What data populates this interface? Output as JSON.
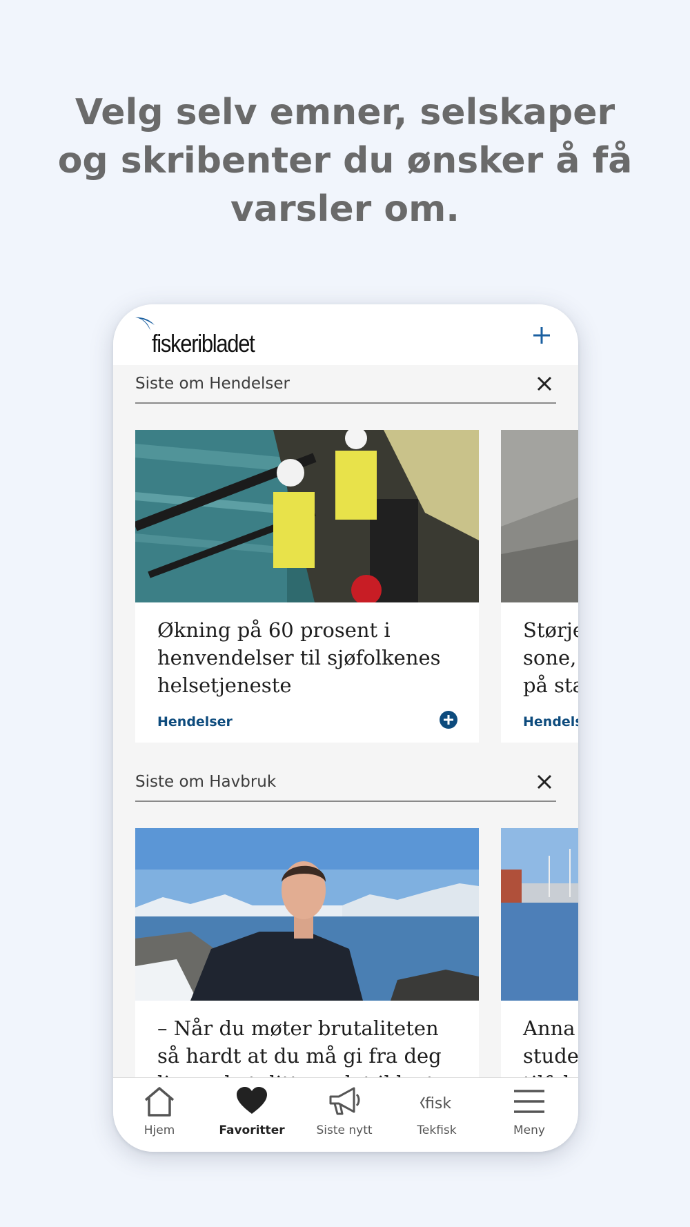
{
  "promo": {
    "headline_lines": [
      "Velg selv emner, selskaper",
      "og skribenter du ønsker å få",
      "varsler om."
    ]
  },
  "app": {
    "logo_text": "fiskeribladet",
    "add_icon": "plus-icon",
    "accent_color": "#0d4b7d"
  },
  "sections": [
    {
      "title": "Siste om Hendelser",
      "close_icon": "close-icon",
      "cards": [
        {
          "title": "Økning på 60 prosent i henvendelser til sjøfolkenes helsetjeneste",
          "tag": "Hendelser",
          "follow_icon": "plus-circle-icon"
        },
        {
          "title_fragment": "Størje sone, på sta",
          "title_lines": [
            "Størje",
            "sone,",
            "på sta"
          ],
          "tag": "Hendels"
        }
      ]
    },
    {
      "title": "Siste om Havbruk",
      "close_icon": "close-icon",
      "cards": [
        {
          "title": "– Når du møter brutaliteten så hardt at du må gi fra deg livsverket ditt, er det ikke t..."
        },
        {
          "title_lines": [
            "Anna",
            "stude",
            "tilfel"
          ]
        }
      ]
    }
  ],
  "tabbar": {
    "tabs": [
      {
        "label": "Hjem",
        "icon": "home-icon",
        "active": false
      },
      {
        "label": "Favoritter",
        "icon": "heart-icon",
        "active": true
      },
      {
        "label": "Siste nytt",
        "icon": "megaphone-icon",
        "active": false
      },
      {
        "label": "Tekfisk",
        "icon": "tekfisk-logo-icon",
        "active": false
      },
      {
        "label": "Meny",
        "icon": "menu-icon",
        "active": false
      }
    ]
  }
}
